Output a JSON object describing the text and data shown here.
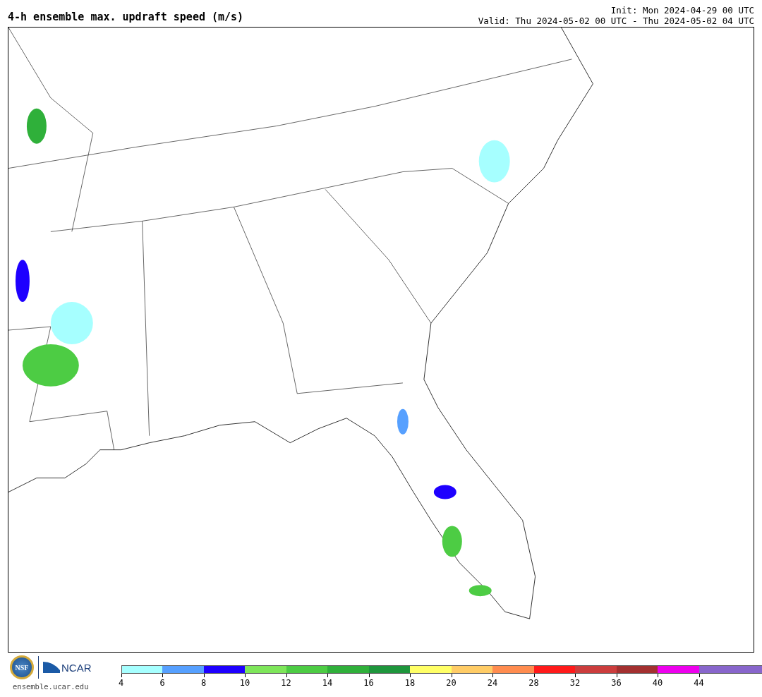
{
  "title": "4-h ensemble max. updraft speed (m/s)",
  "init": "Init: Mon 2024-04-29 00 UTC",
  "valid": "Valid: Thu 2024-05-02 00 UTC - Thu 2024-05-02 04 UTC",
  "logos": {
    "nsf": "NSF",
    "ncar": "NCAR",
    "url": "ensemble.ucar.edu"
  },
  "legend": {
    "bins": [
      {
        "color": "#a6ffff",
        "label": "4"
      },
      {
        "color": "#56a0ff",
        "label": "6"
      },
      {
        "color": "#1e00ff",
        "label": "8"
      },
      {
        "color": "#7ee65a",
        "label": "10"
      },
      {
        "color": "#4dcc44",
        "label": "12"
      },
      {
        "color": "#2fb03a",
        "label": "14"
      },
      {
        "color": "#1e963c",
        "label": "16"
      },
      {
        "color": "#ffff66",
        "label": "18"
      },
      {
        "color": "#ffcc66",
        "label": "20"
      },
      {
        "color": "#ff8c4f",
        "label": "24"
      },
      {
        "color": "#ff1a1a",
        "label": "28"
      },
      {
        "color": "#cc3d3d",
        "label": "32"
      },
      {
        "color": "#a33030",
        "label": "36"
      },
      {
        "color": "#ee00ee",
        "label": "40"
      },
      {
        "color": "#8866cc",
        "label": "44"
      },
      {
        "color": "#8866cc"
      }
    ]
  }
}
